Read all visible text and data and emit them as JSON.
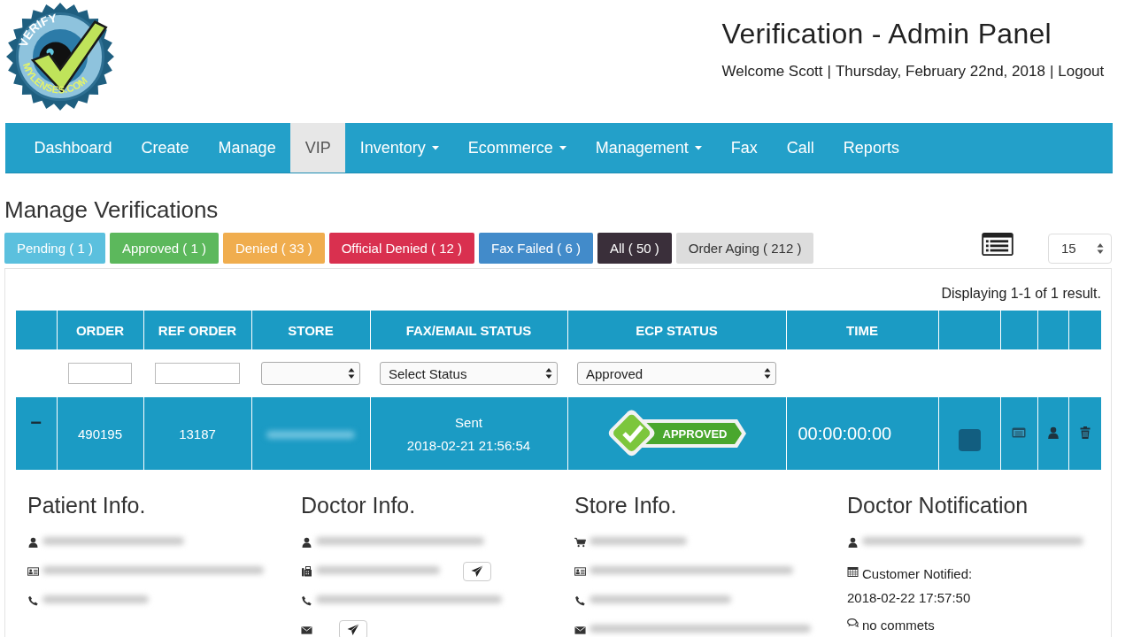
{
  "logo": {
    "top": "VERIFY",
    "bottom": "MYLENSES.COM"
  },
  "header": {
    "title": "Verification - Admin Panel",
    "welcome": "Welcome Scott",
    "separators": [
      "|",
      "|"
    ],
    "date": "Thursday, February 22nd, 2018",
    "logout": "Logout"
  },
  "nav": [
    {
      "label": "Dashboard",
      "selected": false,
      "dropdown": false
    },
    {
      "label": "Create",
      "selected": false,
      "dropdown": false
    },
    {
      "label": "Manage",
      "selected": false,
      "dropdown": false
    },
    {
      "label": "VIP",
      "selected": true,
      "dropdown": false
    },
    {
      "label": "Inventory",
      "selected": false,
      "dropdown": true
    },
    {
      "label": "Ecommerce",
      "selected": false,
      "dropdown": true
    },
    {
      "label": "Management",
      "selected": false,
      "dropdown": true
    },
    {
      "label": "Fax",
      "selected": false,
      "dropdown": false
    },
    {
      "label": "Call",
      "selected": false,
      "dropdown": false
    },
    {
      "label": "Reports",
      "selected": false,
      "dropdown": false
    }
  ],
  "page_title": "Manage Verifications",
  "filters": [
    {
      "label": "Pending ( 1 )",
      "color": "#5bc0de"
    },
    {
      "label": "Approved ( 1 )",
      "color": "#5cb85c"
    },
    {
      "label": "Denied ( 33 )",
      "color": "#f0ad4e"
    },
    {
      "label": "Official Denied ( 12 )",
      "color": "#d9304f"
    },
    {
      "label": "Fax Failed ( 6 )",
      "color": "#428bca"
    },
    {
      "label": "All ( 50 )",
      "color": "#3a2f3a"
    },
    {
      "label": "Order Aging ( 212 )",
      "color": "#dddddd"
    }
  ],
  "page_size": "15",
  "result_count": "Displaying 1-1 of 1 result.",
  "table": {
    "columns": [
      "ORDER",
      "REF ORDER",
      "STORE",
      "FAX/EMAIL STATUS",
      "ECP STATUS",
      "TIME"
    ],
    "filter_row": [
      {
        "kind": "input"
      },
      {
        "kind": "input"
      },
      {
        "kind": "select"
      },
      {
        "kind": "select",
        "value": "Select Status"
      },
      {
        "kind": "select",
        "value": "Approved"
      },
      {
        "kind": "none"
      }
    ],
    "rows": [
      {
        "toggle": "−",
        "order": "490195",
        "ref_order": "13187",
        "store_redacted": true,
        "fax_status": "Sent",
        "fax_time": "2018-02-21 21:56:54",
        "ecp_status": "APPROVED",
        "time": "00:00:00:00"
      }
    ]
  },
  "sections": [
    {
      "title": "Patient Info.",
      "lines": [
        {
          "kind": "user",
          "redacted": true,
          "send_button": false
        },
        {
          "kind": "id-card",
          "redacted": true,
          "send_button": false
        },
        {
          "kind": "phone",
          "redacted": true,
          "send_button": false
        }
      ]
    },
    {
      "title": "Doctor Info.",
      "lines": [
        {
          "kind": "user",
          "redacted": true,
          "send_button": false
        },
        {
          "kind": "fax",
          "redacted": true,
          "send_button": true
        },
        {
          "kind": "phone",
          "redacted": true,
          "send_button": false
        },
        {
          "kind": "envelope",
          "redacted": false,
          "send_button": true
        }
      ]
    },
    {
      "title": "Store Info.",
      "lines": [
        {
          "kind": "cart",
          "redacted": true,
          "send_button": false
        },
        {
          "kind": "id-card",
          "redacted": true,
          "send_button": false
        },
        {
          "kind": "phone",
          "redacted": true,
          "send_button": false
        },
        {
          "kind": "envelope",
          "redacted": true,
          "send_button": false
        }
      ]
    },
    {
      "title": "Doctor Notification",
      "lines": [
        {
          "kind": "user",
          "redacted": true,
          "send_button": false
        },
        {
          "kind": "calendar",
          "redacted": false,
          "text": "Customer Notified:",
          "detail": "2018-02-22 17:57:50",
          "send_button": false
        },
        {
          "kind": "comments",
          "redacted": false,
          "text": "no commets",
          "send_button": false
        }
      ]
    }
  ]
}
